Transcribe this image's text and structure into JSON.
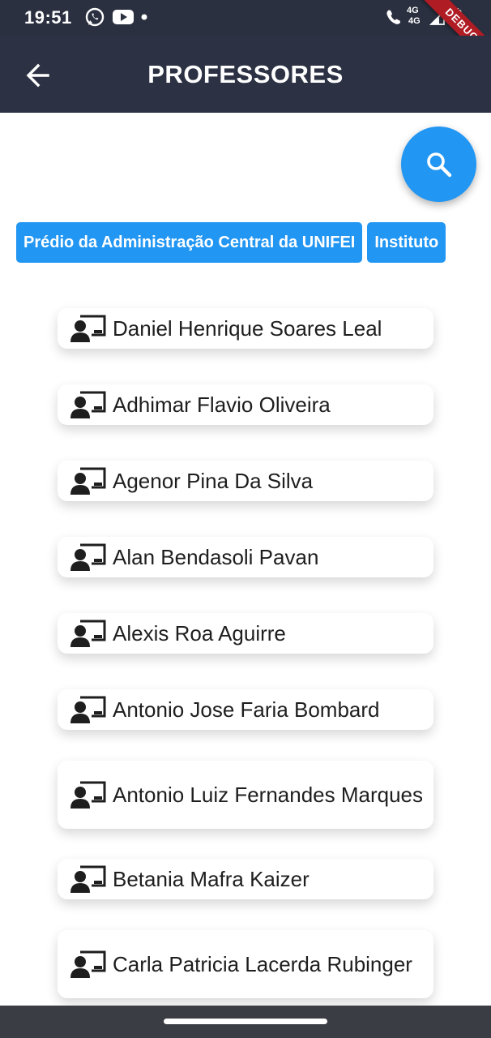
{
  "status_bar": {
    "time": "19:51",
    "network_1": "4G",
    "network_2": "4G",
    "debug_label": "DEBUG"
  },
  "app_bar": {
    "title": "PROFESSORES"
  },
  "icons": {
    "back": "arrow-back-icon",
    "search": "search-icon",
    "card": "teacher-icon"
  },
  "colors": {
    "app_bar": "#2c3244",
    "accent": "#2196f3",
    "card": "#ffffff",
    "debug": "#b01c24"
  },
  "chips": [
    {
      "label": "Prédio da Administração Central da UNIFEI"
    },
    {
      "label": "Instituto"
    }
  ],
  "professors": [
    {
      "name": "Daniel Henrique Soares Leal"
    },
    {
      "name": "Adhimar Flavio Oliveira"
    },
    {
      "name": "Agenor Pina Da Silva"
    },
    {
      "name": "Alan Bendasoli Pavan"
    },
    {
      "name": "Alexis Roa Aguirre"
    },
    {
      "name": "Antonio Jose Faria Bombard"
    },
    {
      "name": "Antonio Luiz Fernandes Marques"
    },
    {
      "name": "Betania Mafra Kaizer"
    },
    {
      "name": "Carla Patricia Lacerda Rubinger"
    }
  ]
}
